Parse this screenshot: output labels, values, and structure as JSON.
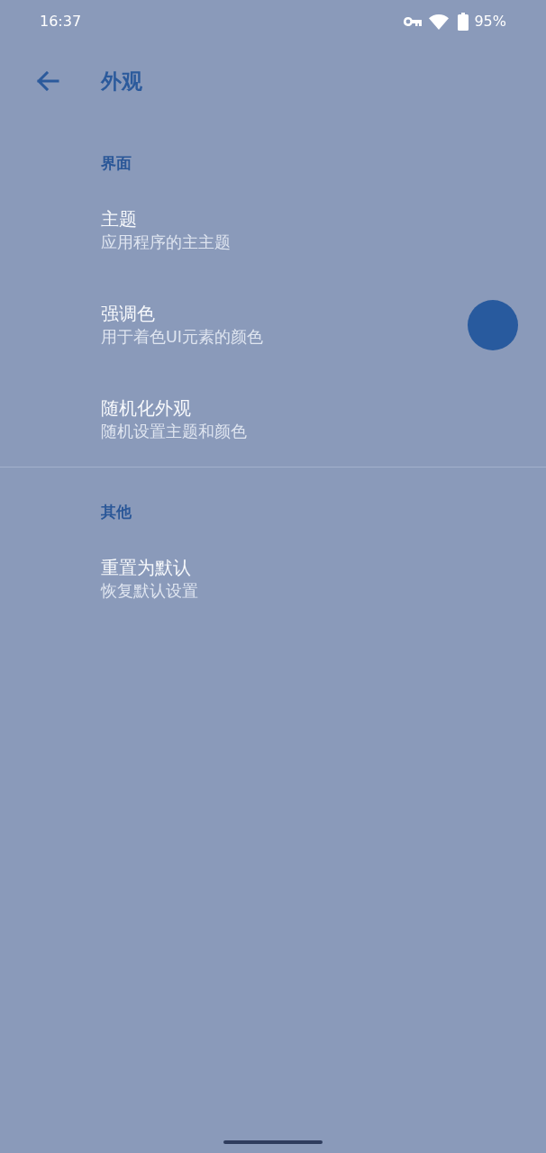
{
  "status_bar": {
    "time": "16:37",
    "battery": "95%"
  },
  "toolbar": {
    "title": "外观"
  },
  "sections": [
    {
      "header": "界面",
      "items": [
        {
          "kind": "plain",
          "title": "主题",
          "summary": "应用程序的主主题"
        },
        {
          "kind": "color",
          "title": "强调色",
          "summary": "用于着色UI元素的颜色",
          "color": "#285a9e"
        },
        {
          "kind": "plain",
          "title": "随机化外观",
          "summary": "随机设置主题和颜色"
        }
      ]
    },
    {
      "header": "其他",
      "items": [
        {
          "kind": "plain",
          "title": "重置为默认",
          "summary": "恢复默认设置"
        }
      ]
    }
  ]
}
